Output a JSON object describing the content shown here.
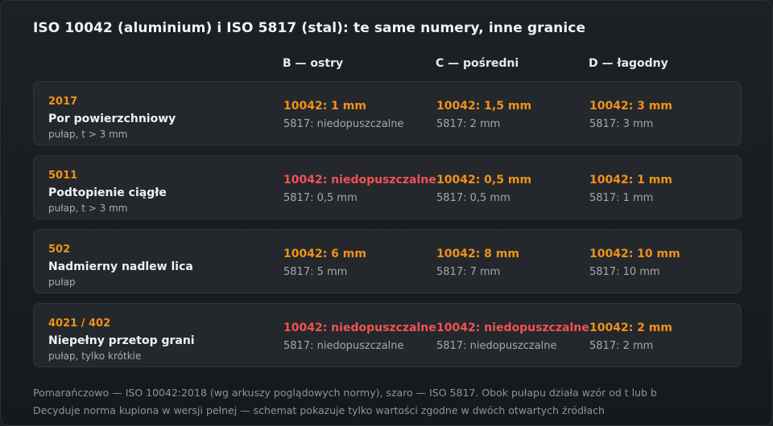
{
  "title": "ISO 10042 (aluminium) i ISO 5817 (stal): te same numery, inne granice",
  "columns": [
    "B — ostry",
    "C — pośredni",
    "D — łagodny"
  ],
  "colors": {
    "iso10042": "#f0911a",
    "not_allowed": "#f05252",
    "iso5817": "#a3a8ad"
  },
  "rows": [
    {
      "code": "2017",
      "name": "Por powierzchniowy",
      "note": "pułap, t > 3 mm",
      "cells": [
        {
          "a": "10042: 1 mm",
          "a_allowed": true,
          "b": "5817: niedopuszczalne"
        },
        {
          "a": "10042: 1,5 mm",
          "a_allowed": true,
          "b": "5817: 2 mm"
        },
        {
          "a": "10042: 3 mm",
          "a_allowed": true,
          "b": "5817: 3 mm"
        }
      ]
    },
    {
      "code": "5011",
      "name": "Podtopienie ciągłe",
      "note": "pułap, t > 3 mm",
      "cells": [
        {
          "a": "10042: niedopuszczalne",
          "a_allowed": false,
          "b": "5817: 0,5 mm"
        },
        {
          "a": "10042: 0,5 mm",
          "a_allowed": true,
          "b": "5817: 0,5 mm"
        },
        {
          "a": "10042: 1 mm",
          "a_allowed": true,
          "b": "5817: 1 mm"
        }
      ]
    },
    {
      "code": "502",
      "name": "Nadmierny nadlew lica",
      "note": "pułap",
      "cells": [
        {
          "a": "10042: 6 mm",
          "a_allowed": true,
          "b": "5817: 5 mm"
        },
        {
          "a": "10042: 8 mm",
          "a_allowed": true,
          "b": "5817: 7 mm"
        },
        {
          "a": "10042: 10 mm",
          "a_allowed": true,
          "b": "5817: 10 mm"
        }
      ]
    },
    {
      "code": "4021 / 402",
      "name": "Niepełny przetop grani",
      "note": "pułap, tylko krótkie",
      "cells": [
        {
          "a": "10042: niedopuszczalne",
          "a_allowed": false,
          "b": "5817: niedopuszczalne"
        },
        {
          "a": "10042: niedopuszczalne",
          "a_allowed": false,
          "b": "5817: niedopuszczalne"
        },
        {
          "a": "10042: 2 mm",
          "a_allowed": true,
          "b": "5817: 2 mm"
        }
      ]
    }
  ],
  "footer": [
    "Pomarańczowo — ISO 10042:2018 (wg arkuszy poglądowych normy), szaro — ISO 5817. Obok pułapu działa wzór od t lub b",
    "Decyduje norma kupiona w wersji pełnej — schemat pokazuje tylko wartości zgodne w dwóch otwartych źródłach"
  ]
}
